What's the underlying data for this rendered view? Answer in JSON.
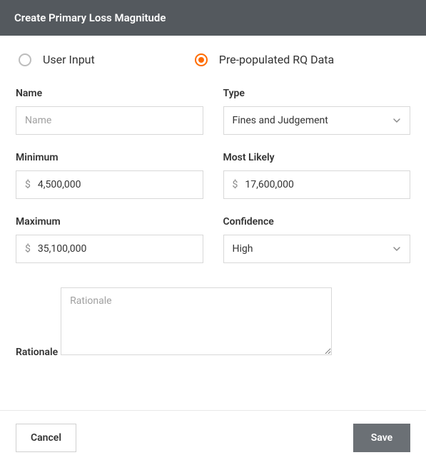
{
  "header": {
    "title": "Create Primary Loss Magnitude"
  },
  "radios": {
    "user_input": {
      "label": "User Input",
      "selected": false
    },
    "rq_data": {
      "label": "Pre-populated RQ Data",
      "selected": true
    }
  },
  "fields": {
    "name": {
      "label": "Name",
      "placeholder": "Name",
      "value": ""
    },
    "type": {
      "label": "Type",
      "value": "Fines and Judgement"
    },
    "minimum": {
      "label": "Minimum",
      "currency": "$",
      "value": "4,500,000"
    },
    "most_likely": {
      "label": "Most Likely",
      "currency": "$",
      "value": "17,600,000"
    },
    "maximum": {
      "label": "Maximum",
      "currency": "$",
      "value": "35,100,000"
    },
    "confidence": {
      "label": "Confidence",
      "value": "High"
    },
    "rationale": {
      "label": "Rationale",
      "placeholder": "Rationale",
      "value": ""
    }
  },
  "footer": {
    "cancel_label": "Cancel",
    "save_label": "Save"
  }
}
